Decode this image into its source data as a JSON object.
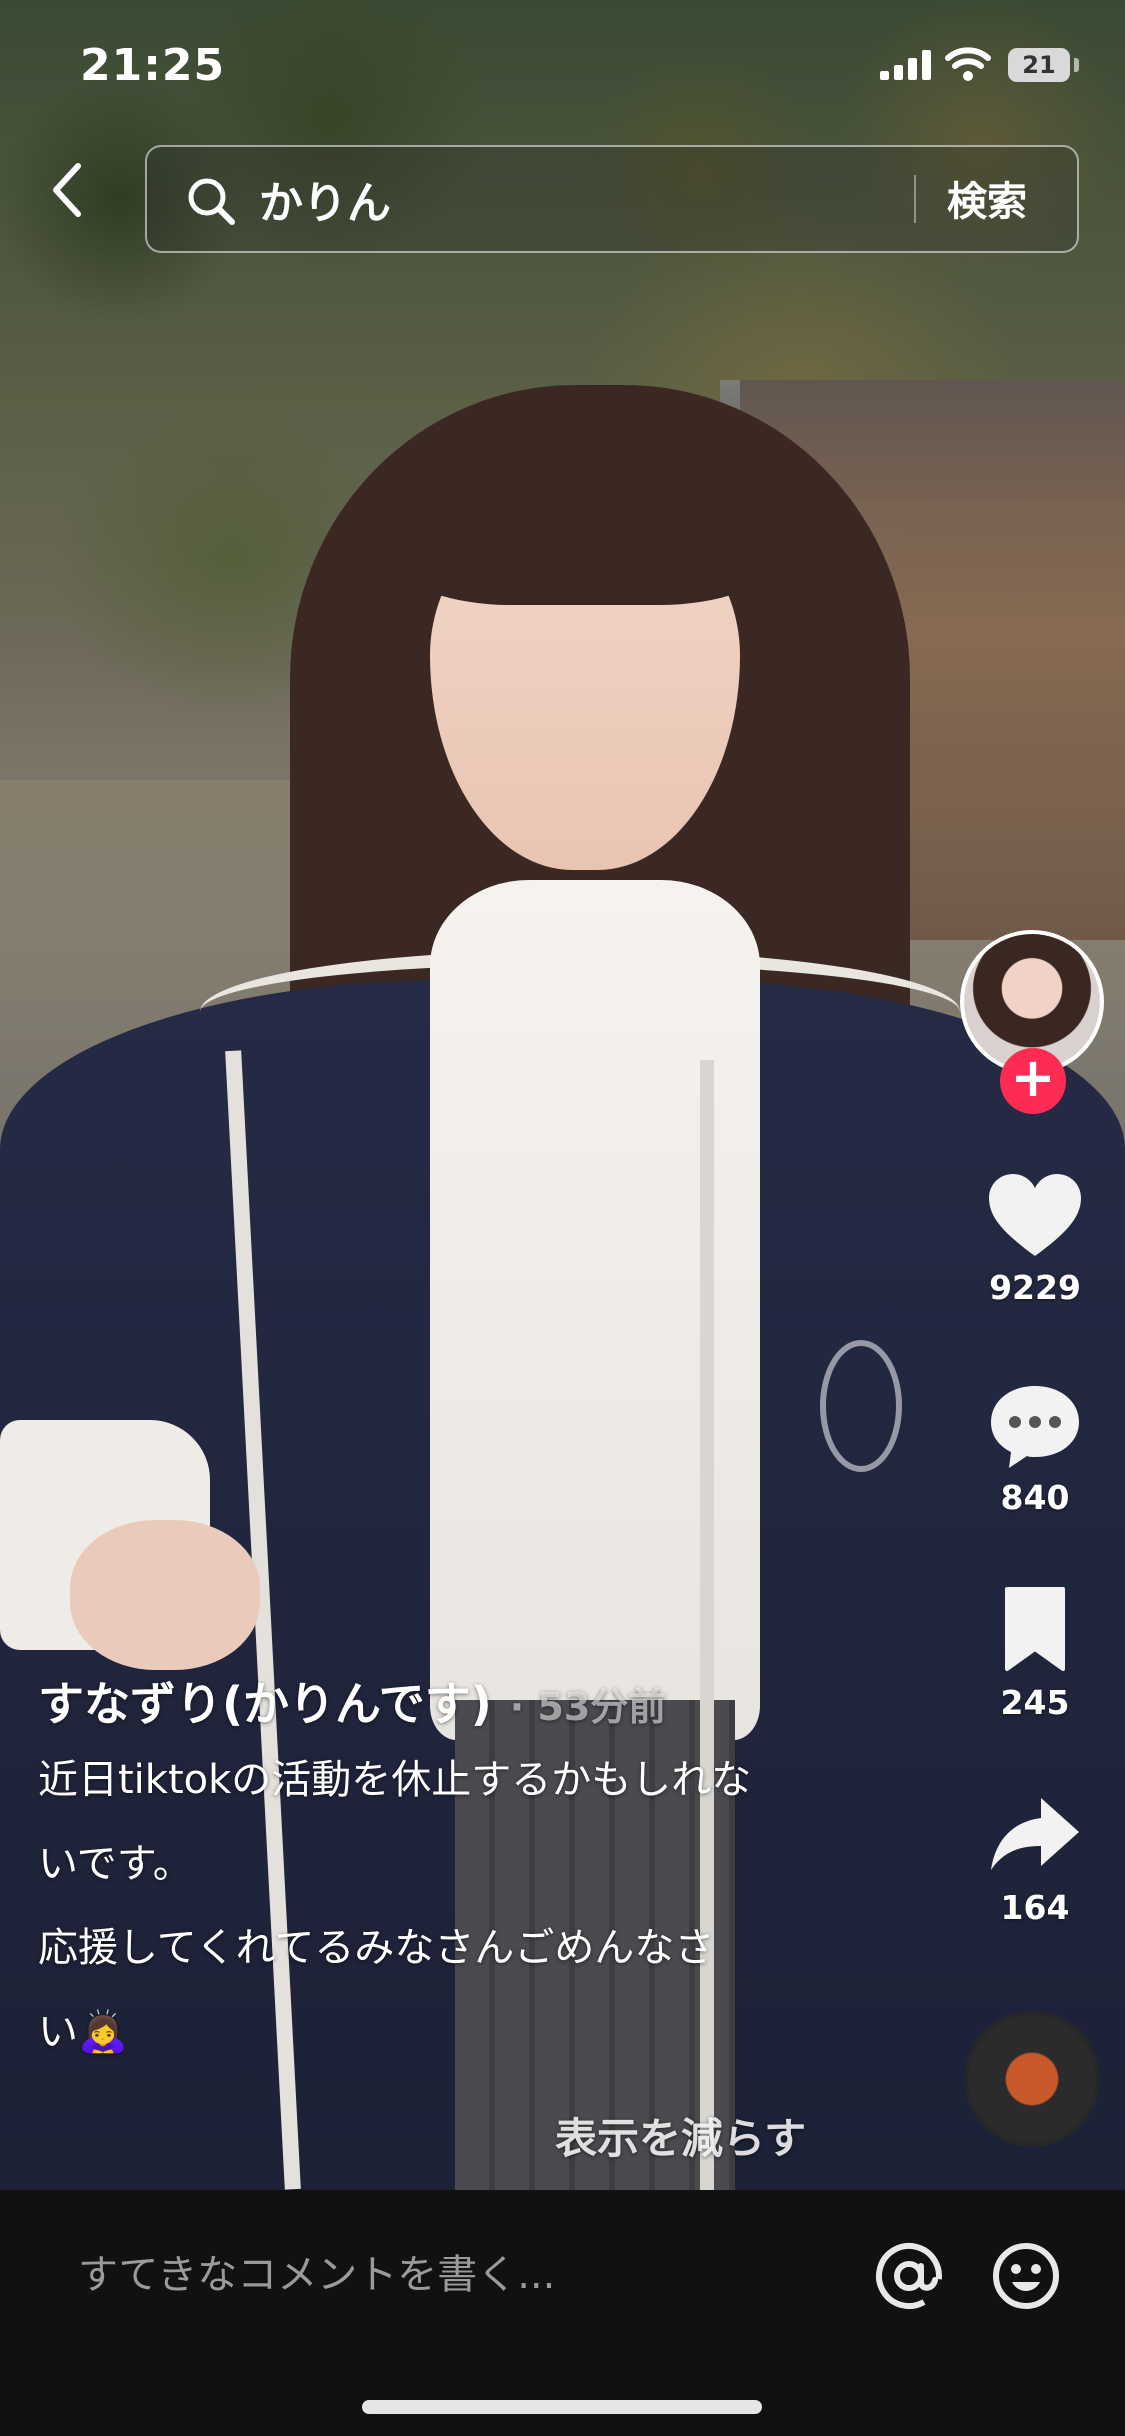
{
  "status_bar": {
    "time": "21:25",
    "battery": "21"
  },
  "search": {
    "back_icon": "chevron-left-icon",
    "query": "かりん",
    "button_label": "検索"
  },
  "rail": {
    "likes": "9229",
    "comments": "840",
    "bookmarks": "245",
    "shares": "164",
    "follow_symbol": "+"
  },
  "caption": {
    "author": "すなずり(かりんです)",
    "time_ago": "· 53分前",
    "lines": [
      "近日tiktokの活動を休止するかもしれな",
      "いです。",
      "応援してくれてるみなさんごめんなさ",
      "い🙇‍♀️"
    ],
    "show_less": "表示を減らす"
  },
  "comment_bar": {
    "placeholder": "すてきなコメントを書く..."
  },
  "colors": {
    "follow_accent": "#fe2c55",
    "comment_bar_bg": "#111111"
  }
}
